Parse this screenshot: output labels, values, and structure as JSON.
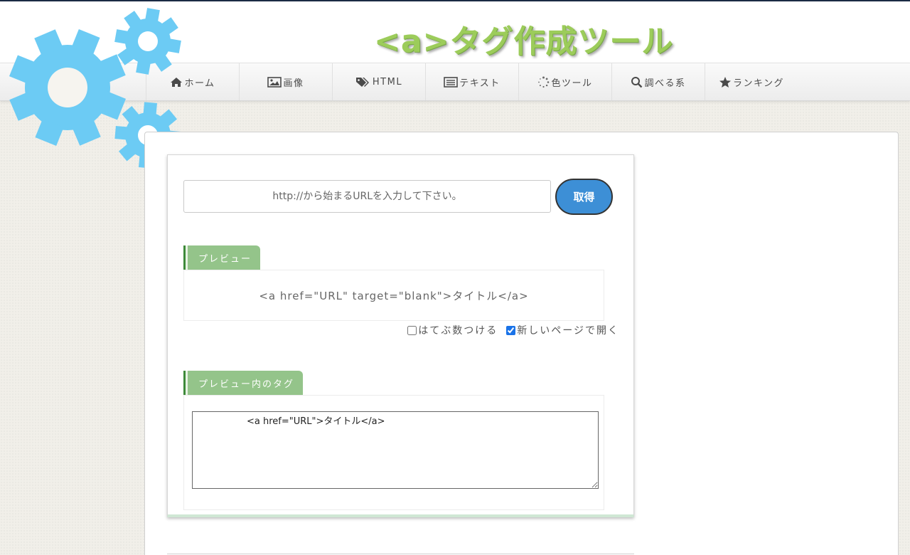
{
  "header": {
    "site_title": "<a>タグ作成ツール"
  },
  "nav": {
    "items": [
      {
        "label": "ホーム",
        "icon": "home-icon"
      },
      {
        "label": "画像",
        "icon": "image-icon"
      },
      {
        "label": "HTML",
        "icon": "tag-icon"
      },
      {
        "label": "テキスト",
        "icon": "text-icon"
      },
      {
        "label": "色ツール",
        "icon": "spinner-icon"
      },
      {
        "label": "調べる系",
        "icon": "search-icon"
      },
      {
        "label": "ランキング",
        "icon": "star-icon"
      }
    ]
  },
  "tool": {
    "url_placeholder": "http://から始まるURLを入力して下さい。",
    "url_value": "",
    "get_button": "取得",
    "preview_tab": "プレビュー",
    "preview_text": "<a href=\"URL\" target=\"blank\">タイトル</a>",
    "option_hatebu": "はてぶ数つける",
    "option_hatebu_checked": false,
    "option_new_page": "新しいページで開く",
    "option_new_page_checked": true,
    "tag_tab": "プレビュー内のタグ",
    "tag_value": "<a href=\"URL\">タイトル</a>"
  },
  "colors": {
    "accent_green": "#94c48a",
    "button_blue": "#3d8fd6",
    "gear_blue": "#6ccbf4",
    "title_green": "#9ccc5a"
  }
}
